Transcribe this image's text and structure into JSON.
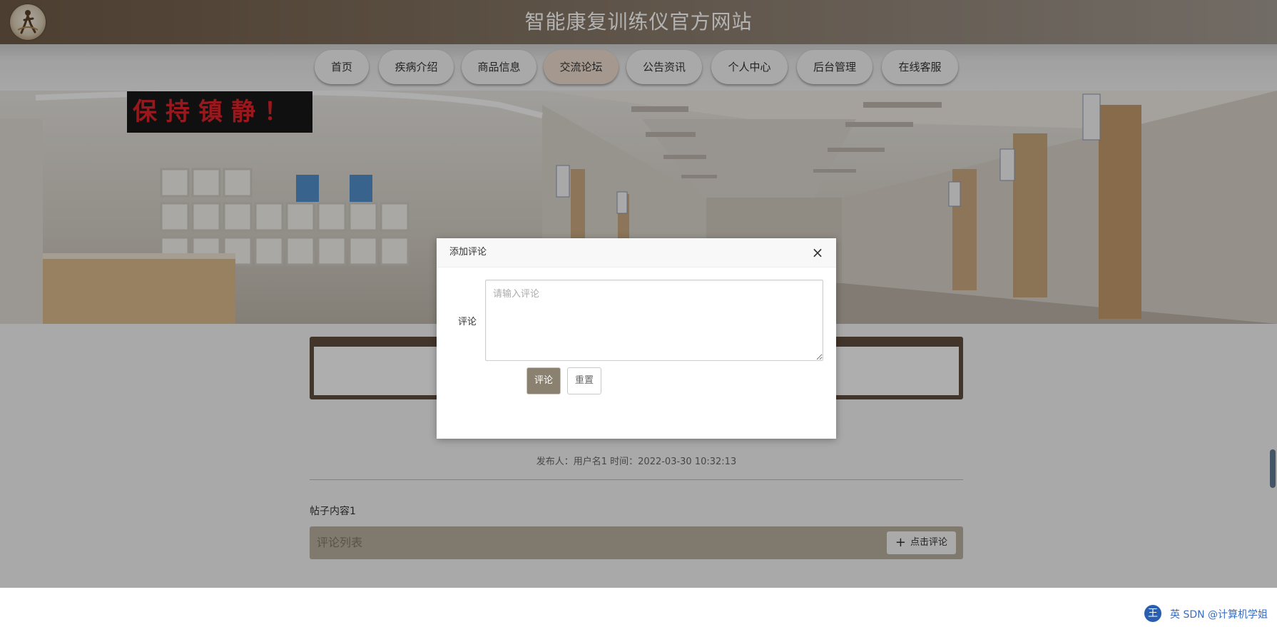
{
  "site": {
    "title": "智能康复训练仪官方网站"
  },
  "nav": {
    "items": [
      {
        "label": "首页"
      },
      {
        "label": "疾病介绍"
      },
      {
        "label": "商品信息"
      },
      {
        "label": "交流论坛"
      },
      {
        "label": "公告资讯"
      },
      {
        "label": "个人中心"
      },
      {
        "label": "后台管理"
      },
      {
        "label": "在线客服"
      }
    ],
    "active_index": 3,
    "active_color": "#ecdccd"
  },
  "banner": {
    "sign_text": "保持镇静！"
  },
  "post": {
    "meta": "发布人：用户名1 时间：2022-03-30 10:32:13",
    "content": "帖子内容1",
    "comments_title": "评论列表",
    "add_comment_label": "点击评论"
  },
  "dialog": {
    "title": "添加评论",
    "close_label": "×",
    "field_label": "评论",
    "textarea_placeholder": "请输入评论",
    "textarea_value": "",
    "submit_label": "评论",
    "reset_label": "重置"
  },
  "watermark": {
    "badge": "王",
    "text": "英 SDN @计算机学姐"
  },
  "colors": {
    "header_start": "#6e5a45",
    "submit_button": "#8a8170",
    "title_border": "#5f4d3d"
  }
}
